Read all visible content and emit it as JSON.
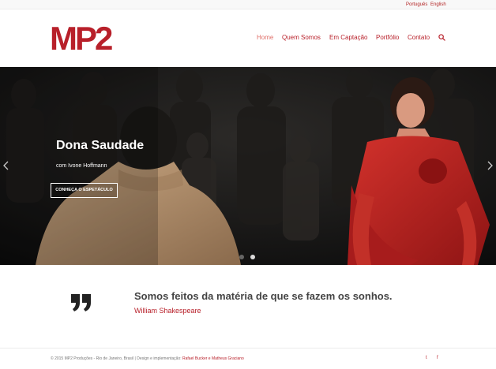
{
  "language_bar": {
    "portuguese": "Português",
    "english": "English"
  },
  "header": {
    "logo_text": "MP2",
    "nav": [
      {
        "label": "Home",
        "active": true
      },
      {
        "label": "Quem Somos",
        "active": false
      },
      {
        "label": "Em Captação",
        "active": false
      },
      {
        "label": "Portfólio",
        "active": false
      },
      {
        "label": "Contato",
        "active": false
      }
    ],
    "search_icon": "search-icon"
  },
  "hero": {
    "title": "Dona Saudade",
    "subtitle": "com Ivone Hoffmann",
    "button_label": "CONHEÇA O ESPETÁCULO",
    "slide_count": 2,
    "active_slide": 2,
    "prev_icon": "chevron-left-icon",
    "next_icon": "chevron-right-icon"
  },
  "quote": {
    "icon": "quote-icon",
    "text": "Somos feitos da matéria de que se fazem os sonhos.",
    "author": "William Shakespeare"
  },
  "footer": {
    "copyright": "© 2015 MP2 Produções - Rio de Janeiro, Brasil | Design e implementação: ",
    "credit": "Rafael Bucker e Matheus Graciano",
    "social": [
      {
        "icon": "twitter-icon",
        "glyph": "t"
      },
      {
        "icon": "facebook-icon",
        "glyph": "f"
      }
    ]
  },
  "colors": {
    "brand_red": "#b8202a",
    "nav_active": "#e0706a",
    "actress_red": "#c0282a"
  }
}
